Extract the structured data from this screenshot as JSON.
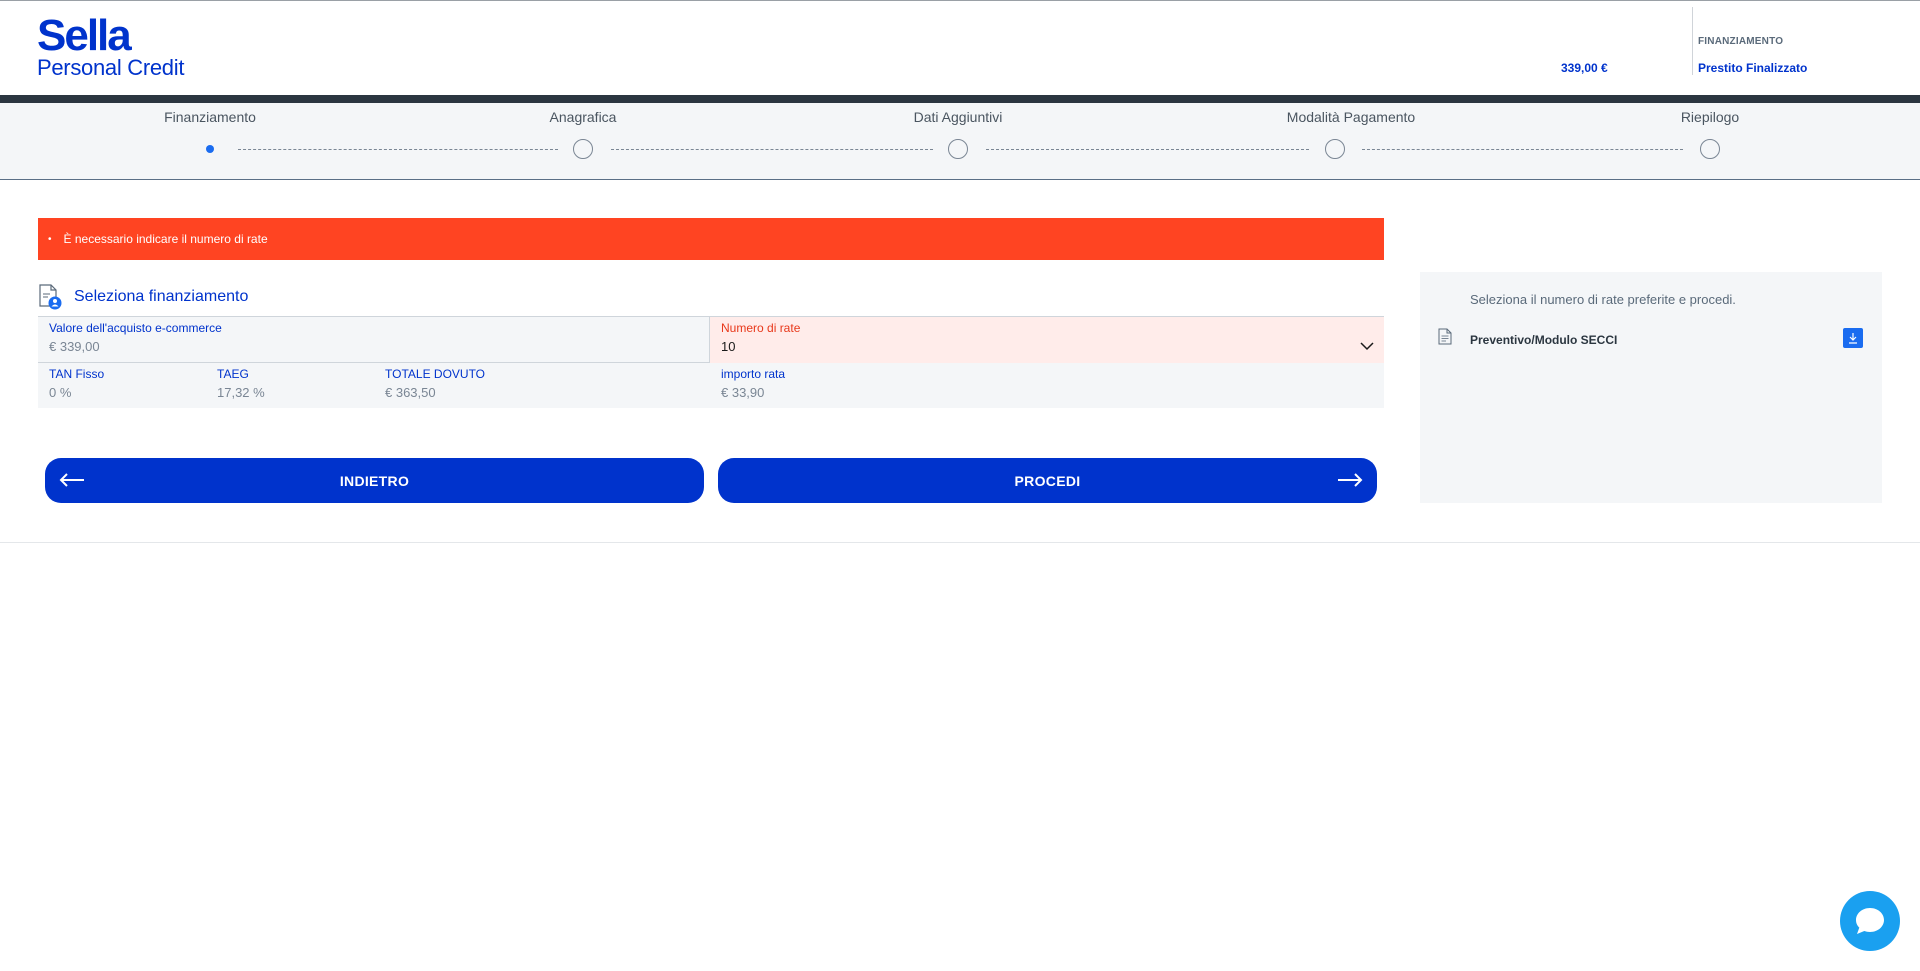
{
  "header": {
    "logo_main": "Sella",
    "logo_sub": "Personal Credit",
    "amount": "339,00 €",
    "financing_label": "FINANZIAMENTO",
    "financing_value": "Prestito Finalizzato"
  },
  "stepper": {
    "steps": [
      {
        "label": "Finanziamento",
        "active": true
      },
      {
        "label": "Anagrafica",
        "active": false
      },
      {
        "label": "Dati Aggiuntivi",
        "active": false
      },
      {
        "label": "Modalità Pagamento",
        "active": false
      },
      {
        "label": "Riepilogo",
        "active": false
      }
    ]
  },
  "alert": {
    "bullet": "•",
    "message": "È necessario indicare il numero di rate"
  },
  "section": {
    "title": "Seleziona finanziamento"
  },
  "form": {
    "purchase_value_label": "Valore dell'acquisto e-commerce",
    "purchase_value": "€ 339,00",
    "installments_label": "Numero di rate",
    "installments_value": "10",
    "tan_label": "TAN Fisso",
    "tan_value": "0 %",
    "taeg_label": "TAEG",
    "taeg_value": "17,32 %",
    "total_label": "TOTALE DOVUTO",
    "total_value": "€ 363,50",
    "installment_amount_label": "importo rata",
    "installment_amount_value": "€ 33,90"
  },
  "buttons": {
    "back_label": "INDIETRO",
    "next_label": "PROCEDI"
  },
  "side_panel": {
    "hint": "Seleziona il numero di rate preferite e procedi.",
    "document_label": "Preventivo/Modulo SECCI"
  },
  "colors": {
    "brand_blue": "#0033cc",
    "error_red": "#ff4422",
    "accent_blue": "#1a6cf0",
    "chat_blue": "#1aa0f0"
  },
  "icons": {
    "section": "document-user-icon",
    "chevron": "chevron-down-icon",
    "back": "arrow-left-icon",
    "next": "arrow-right-icon",
    "doc": "document-icon",
    "download": "download-icon",
    "chat": "chat-bubble-icon"
  }
}
